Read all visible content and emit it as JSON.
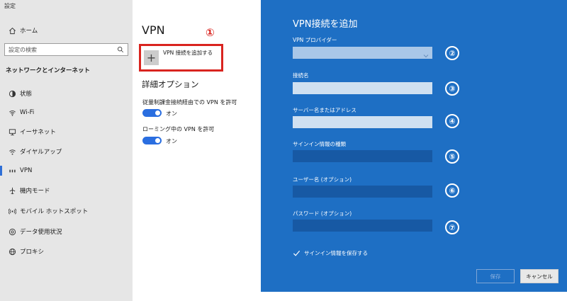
{
  "window": {
    "title": "設定"
  },
  "nav": {
    "home": {
      "label": "ホーム",
      "icon": "home-icon"
    },
    "search": {
      "placeholder": "設定の検索",
      "icon": "search-icon"
    },
    "section": "ネットワークとインターネット",
    "items": [
      {
        "label": "状態",
        "icon": "status-icon"
      },
      {
        "label": "Wi-Fi",
        "icon": "wifi-icon"
      },
      {
        "label": "イーサネット",
        "icon": "ethernet-icon"
      },
      {
        "label": "ダイヤルアップ",
        "icon": "dialup-icon"
      },
      {
        "label": "VPN",
        "icon": "vpn-icon",
        "active": true
      },
      {
        "label": "機内モード",
        "icon": "airplane-icon"
      },
      {
        "label": "モバイル ホットスポット",
        "icon": "hotspot-icon"
      },
      {
        "label": "データ使用状況",
        "icon": "data-usage-icon"
      },
      {
        "label": "プロキシ",
        "icon": "globe-icon"
      }
    ]
  },
  "vpn_panel": {
    "title": "VPN",
    "callout": "①",
    "add_button": {
      "label": "VPN 接続を追加する",
      "icon": "plus-icon"
    },
    "advanced_title": "詳細オプション",
    "options": [
      {
        "label": "従量制課金接続経由での VPN を許可",
        "state": "オン"
      },
      {
        "label": "ローミング中の VPN を許可",
        "state": "オン"
      }
    ]
  },
  "dialog": {
    "title": "VPN接続を追加",
    "fields": [
      {
        "label": "VPN プロバイダー",
        "value": "",
        "callout": "②"
      },
      {
        "label": "接続名",
        "value": "",
        "callout": "③"
      },
      {
        "label": "サーバー名またはアドレス",
        "value": "",
        "callout": "④"
      },
      {
        "label": "サインイン情報の種類",
        "value": "",
        "callout": "⑤"
      },
      {
        "label": "ユーザー名 (オプション)",
        "value": "",
        "callout": "⑥"
      },
      {
        "label": "パスワード (オプション)",
        "value": "",
        "callout": "⑦"
      }
    ],
    "remember": {
      "label": "サインイン情報を保存する",
      "checked": true
    },
    "save_label": "保存",
    "cancel_label": "キャンセル"
  },
  "colors": {
    "dialog_bg": "#1e6fc4",
    "toggle_on": "#2a6ee0",
    "callout_red": "#d9241f",
    "nav_bg": "#e6e6e6"
  }
}
